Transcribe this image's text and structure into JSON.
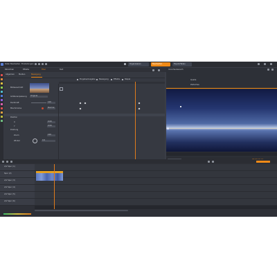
{
  "menu": {
    "items": [
      "Datei",
      "Bearbeiten",
      "Einstellungen"
    ]
  },
  "nav": {
    "items": [
      "Organisieren",
      "Bearbeiten",
      "Export/Teilen"
    ],
    "active_index": 1,
    "accent_color": "#f08a17"
  },
  "panel_tabs": [
    "Bibliothek",
    "Effekte",
    "Titel",
    "Text"
  ],
  "sub_tabs": [
    "Allgemein",
    "Medien",
    "Bewegung"
  ],
  "filter_options": [
    "Eingabe/Ausgabe",
    "Bewegung",
    "Effekte",
    "Stapel"
  ],
  "properties": {
    "header_label": "Bildausschnitt",
    "rows": [
      {
        "label": "Größenanpassung",
        "value": "Original"
      },
      {
        "label": "Deckkraft",
        "value": "100"
      },
      {
        "label": "Mischmodus",
        "value": "Normal"
      }
    ],
    "section2_title": "Position",
    "section2_rows": [
      {
        "label": "X",
        "value": "0.00"
      },
      {
        "label": "Y",
        "value": "0.00"
      },
      {
        "label": "Zoom",
        "value": "100"
      }
    ],
    "section3_title": "Drehung",
    "section3_rows": [
      {
        "label": "Winkel",
        "value": "0.0"
      }
    ]
  },
  "preview": {
    "title": "Vorschaubereich",
    "tabs": [
      "Quelle",
      "Zeitachse"
    ],
    "active_tab": 1,
    "timecode": "00:00:13.17",
    "sky_colors": [
      "#121a44",
      "#24356f",
      "#4f6aa5",
      "#b7c6e2"
    ]
  },
  "timeline": {
    "tracks": [
      {
        "name": "A/V Spur (1)"
      },
      {
        "name": "Spur (2)"
      },
      {
        "name": "A/V Spur (3)"
      },
      {
        "name": "A/V Spur (4)"
      },
      {
        "name": "A/V Spur (5)"
      },
      {
        "name": "A/V Spur (6)"
      }
    ],
    "clip_color": "#e5a020"
  }
}
